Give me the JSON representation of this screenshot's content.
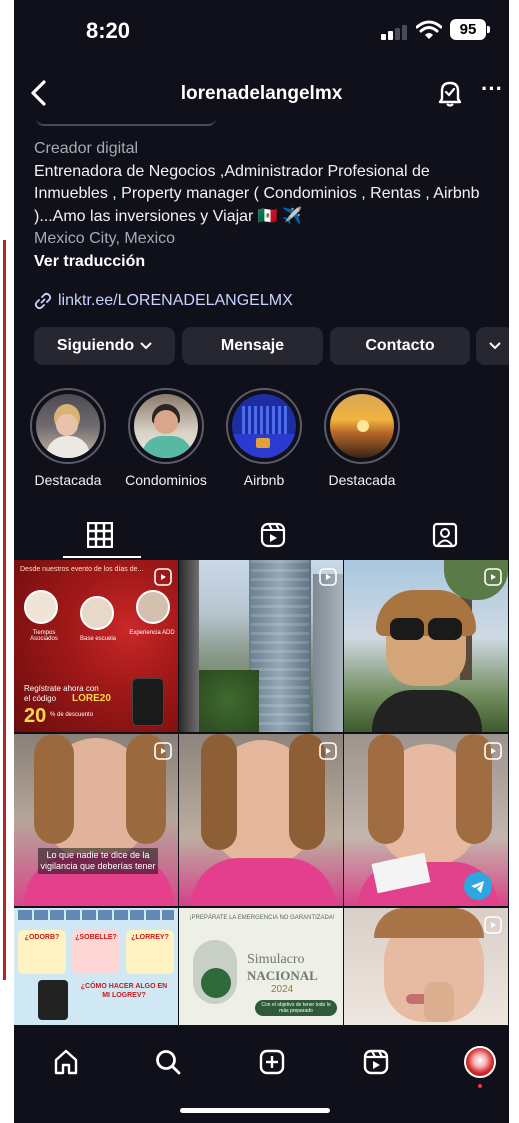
{
  "status_bar": {
    "time": "8:20",
    "battery": "95"
  },
  "header": {
    "username": "lorenadelangelmx"
  },
  "bio": {
    "category": "Creador digital",
    "description": "Entrenadora de Negocios ,Administrador Profesional de Inmuebles , Property manager ( Condominios , Rentas , Airbnb )...Amo las inversiones y Viajar 🇲🇽 ✈️",
    "location": "Mexico City, Mexico",
    "translate": "Ver traducción",
    "link": "linktr.ee/LORENADELANGELMX"
  },
  "buttons": {
    "following": "Siguiendo",
    "message": "Mensaje",
    "contact": "Contacto"
  },
  "highlights": [
    {
      "label": "Destacada"
    },
    {
      "label": "Condominios"
    },
    {
      "label": "Airbnb"
    },
    {
      "label": "Destacada"
    }
  ],
  "tabs": [
    "grid-icon",
    "reels-icon",
    "tagged-icon"
  ],
  "posts": {
    "p1": {
      "top_text": "Desde nuestros evento de los días de...",
      "opt1": "Tiempos Asociados",
      "opt2": "Base escuela",
      "opt3": "Experiencia ADD",
      "line1": "Regístrate ahora con",
      "line2": "el código",
      "code": "LORE20",
      "big": "20",
      "small": "% de descuento"
    },
    "p4": {
      "caption": "Lo que nadie te dice de la vigilancia que deberías tener"
    },
    "p7": {
      "q1": "¿ODORB?",
      "q2": "¿SOBELLE?",
      "q3": "¿LORREY?",
      "q4": "¿CÓMO HACER ALGO EN MI LOGREV?"
    },
    "p8": {
      "banner": "¡PREPÁRATE LA EMERGENCIA NO GARANTIZADA!",
      "title1": "Simulacro",
      "title2": "NACIONAL",
      "year": "2024",
      "pill": "Con el objetivo de tener todo lo más preparado"
    }
  },
  "bottom_nav": [
    "home-icon",
    "search-icon",
    "create-icon",
    "reels-icon",
    "profile-avatar"
  ],
  "colors": {
    "background": "#0f1019",
    "button": "#262731",
    "link": "#c8d4ff",
    "accent_red": "#d62828"
  }
}
